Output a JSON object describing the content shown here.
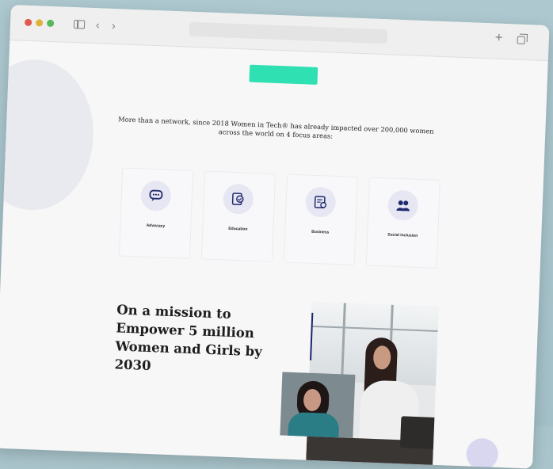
{
  "browser": {
    "url": "",
    "colors": {
      "close": "#e05a4e",
      "minimize": "#e0b23a",
      "maximize": "#58b95a"
    }
  },
  "hero": {
    "cta_label": "",
    "intro_text": "More than a network, since 2018 Women in Tech® has already impacted over 200,000 women across the world on 4 focus areas:",
    "accent_color": "#2ee0b2"
  },
  "focus_areas": [
    {
      "icon": "chat-bubble-icon",
      "title": "Advocacy",
      "desc": ""
    },
    {
      "icon": "education-icon",
      "title": "Education",
      "desc": ""
    },
    {
      "icon": "business-icon",
      "title": "Business",
      "desc": ""
    },
    {
      "icon": "people-icon",
      "title": "Social Inclusion",
      "desc": ""
    }
  ],
  "mission": {
    "heading": "On a mission to Empower 5 million Women and Girls by 2030",
    "paragraph": ""
  }
}
